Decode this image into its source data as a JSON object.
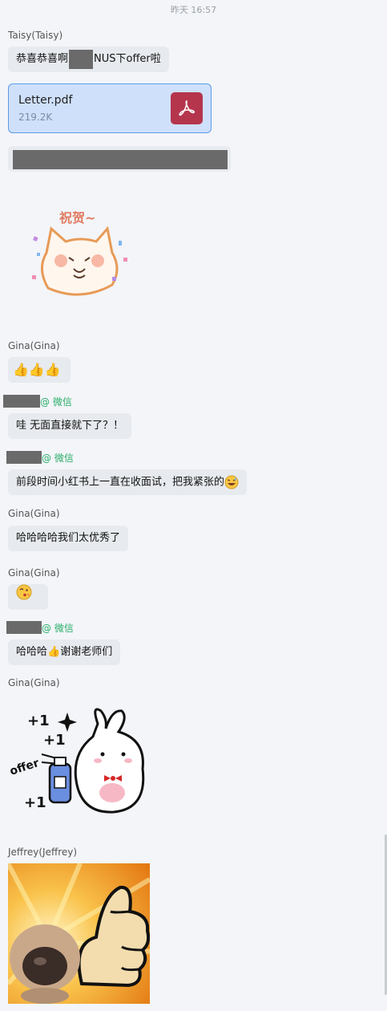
{
  "header": {
    "timestamp": "昨天 16:57"
  },
  "messages": {
    "m1": {
      "sender": "Taisy(Taisy)",
      "text_before": "恭喜恭喜啊",
      "text_after": "NUS下offer啦"
    },
    "m2": {
      "file_name": "Letter.pdf",
      "file_size": "219.2K",
      "file_icon": "pdf-icon"
    },
    "m4": {
      "sticker_text": "祝贺~"
    },
    "m5": {
      "sender": "Gina(Gina)",
      "emoji": "thumbs-up x3"
    },
    "m6": {
      "suffix": "@ 微信",
      "text": "哇 无面直接就下了？！"
    },
    "m7": {
      "suffix": "@ 微信",
      "text": "前段时间小红书上一直在收面试，把我紧张的"
    },
    "m8": {
      "sender": "Gina(Gina)",
      "text": "哈哈哈哈我们太优秀了"
    },
    "m9": {
      "sender": "Gina(Gina)",
      "emoji": "wink-kiss"
    },
    "m10": {
      "suffix": "@ 微信",
      "text_before": "哈哈哈",
      "text_after": "谢谢老师们"
    },
    "m11": {
      "sender": "Gina(Gina)",
      "sticker_text": "offer",
      "sticker_marks": "+1"
    },
    "m12": {
      "sender": "Jeffrey(Jeffrey)"
    }
  },
  "colors": {
    "accent_green": "#2aae67",
    "file_bg": "#cfe0fa",
    "pdf_red": "#b5354d"
  }
}
